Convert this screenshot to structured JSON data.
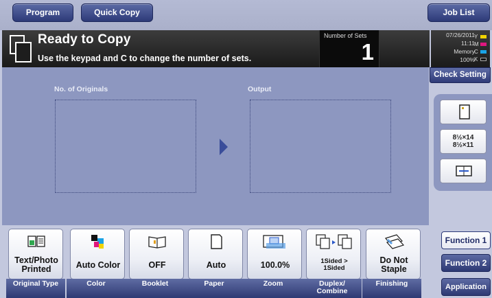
{
  "top_tabs": {
    "program": "Program",
    "quick_copy": "Quick Copy",
    "job_list": "Job List"
  },
  "status": {
    "title": "Ready to Copy",
    "instruction": "Use the keypad and C to change the number of sets.",
    "sets_label": "Number of Sets",
    "sets_value": "1",
    "date": "07/26/2011",
    "time": "11:11",
    "memory_label": "Memory",
    "memory_value": "100%",
    "toner": [
      {
        "letter": "Y",
        "color": "#f1d400"
      },
      {
        "letter": "M",
        "color": "#e0177e"
      },
      {
        "letter": "C",
        "color": "#1aa3e6"
      },
      {
        "letter": "K",
        "color": "#111111"
      }
    ]
  },
  "check_setting": "Check Setting",
  "preview": {
    "originals_label": "No. of Originals",
    "output_label": "Output"
  },
  "side_buttons": {
    "size_label_1": "8½×14",
    "size_label_2": "8½×11"
  },
  "functions": [
    {
      "value": "Text/Photo\nPrinted",
      "label": "Original Type",
      "icon": "original-type-icon"
    },
    {
      "value": "Auto Color",
      "label": "Color",
      "icon": "color-icon"
    },
    {
      "value": "OFF",
      "label": "Booklet",
      "icon": "booklet-icon"
    },
    {
      "value": "Auto",
      "label": "Paper",
      "icon": "paper-icon"
    },
    {
      "value": "100.0%",
      "label": "Zoom",
      "icon": "zoom-icon"
    },
    {
      "value": "1Sided >\n1Sided",
      "label": "Duplex/\nCombine",
      "icon": "duplex-icon"
    },
    {
      "value": "Do Not\nStaple",
      "label": "Finishing",
      "icon": "finishing-icon"
    }
  ],
  "right_tabs": {
    "function1": "Function 1",
    "function2": "Function 2",
    "application": "Application"
  }
}
